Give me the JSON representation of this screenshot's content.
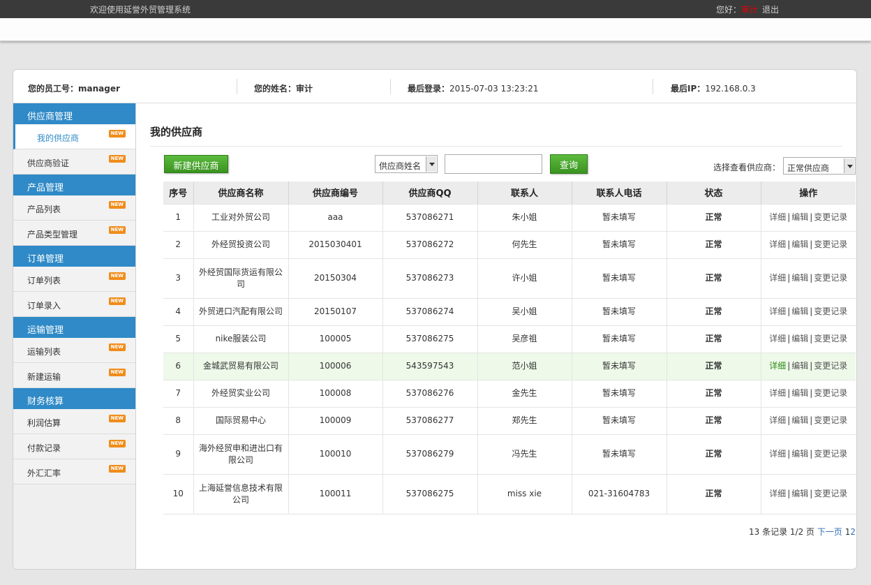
{
  "topbar": {
    "welcome": "欢迎使用延誉外贸管理系统",
    "greeting": "您好：",
    "user": "审计",
    "logout": "退出"
  },
  "info": {
    "employee_label": "您的员工号：",
    "employee_value": "manager",
    "name_label": "您的姓名：",
    "name_value": "审计",
    "last_login_label": "最后登录：",
    "last_login_value": "2015-07-03 13:23:21",
    "last_ip_label": "最后IP：",
    "last_ip_value": "192.168.0.3"
  },
  "sidebar": {
    "badge": "NEW",
    "sections": [
      {
        "title": "供应商管理",
        "items": [
          "我的供应商",
          "供应商验证"
        ]
      },
      {
        "title": "产品管理",
        "items": [
          "产品列表",
          "产品类型管理"
        ]
      },
      {
        "title": "订单管理",
        "items": [
          "订单列表",
          "订单录入"
        ]
      },
      {
        "title": "运输管理",
        "items": [
          "运输列表",
          "新建运输"
        ]
      },
      {
        "title": "财务核算",
        "items": [
          "利润估算",
          "付款记录",
          "外汇汇率"
        ]
      }
    ]
  },
  "main": {
    "title": "我的供应商",
    "new_button": "新建供应商",
    "search_field_select": "供应商姓名",
    "search_value": "",
    "query_button": "查询",
    "filter_label": "选择查看供应商：",
    "filter_select": "正常供应商"
  },
  "table": {
    "headers": [
      "序号",
      "供应商名称",
      "供应商编号",
      "供应商QQ",
      "联系人",
      "联系人电话",
      "状态",
      "操作"
    ],
    "op_labels": [
      "详细",
      "编辑",
      "变更记录"
    ],
    "rows": [
      [
        "1",
        "工业对外贸公司",
        "aaa",
        "537086271",
        "朱小姐",
        "暂未填写",
        "正常"
      ],
      [
        "2",
        "外经贸投资公司",
        "2015030401",
        "537086272",
        "何先生",
        "暂未填写",
        "正常"
      ],
      [
        "3",
        "外经贸国际货运有限公司",
        "20150304",
        "537086273",
        "许小姐",
        "暂未填写",
        "正常"
      ],
      [
        "4",
        "外贸进口汽配有限公司",
        "20150107",
        "537086274",
        "吴小姐",
        "暂未填写",
        "正常"
      ],
      [
        "5",
        "nike服装公司",
        "100005",
        "537086275",
        "吴彦祖",
        "暂未填写",
        "正常"
      ],
      [
        "6",
        "金城武贸易有限公司",
        "100006",
        "543597543",
        "范小姐",
        "暂未填写",
        "正常"
      ],
      [
        "7",
        "外经贸实业公司",
        "100008",
        "537086276",
        "金先生",
        "暂未填写",
        "正常"
      ],
      [
        "8",
        "国际贸易中心",
        "100009",
        "537086277",
        "郑先生",
        "暂未填写",
        "正常"
      ],
      [
        "9",
        "海外经贸申和进出口有限公司",
        "100010",
        "537086279",
        "冯先生",
        "暂未填写",
        "正常"
      ],
      [
        "10",
        "上海延誉信息技术有限公司",
        "100011",
        "537086275",
        "miss xie",
        "021-31604783",
        "正常"
      ]
    ]
  },
  "pager": {
    "summary": "13 条记录 1/2 页",
    "next": "下一页",
    "pages": [
      "1",
      "2"
    ]
  }
}
